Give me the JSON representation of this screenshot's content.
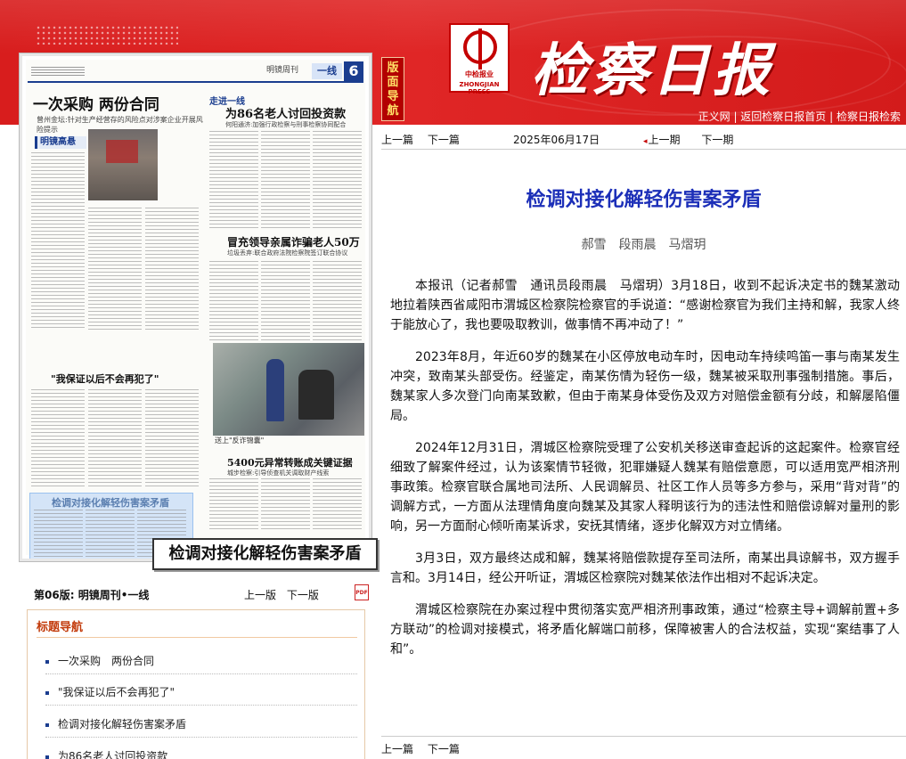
{
  "header": {
    "masthead": "检察日报",
    "logo_text_zh": "中检报业",
    "logo_text_en": "ZHONGJIAN PRESS",
    "topnav": [
      "正义网",
      "返回检察日报首页",
      "检察日报检索"
    ],
    "vertical_tab": "版面导航"
  },
  "thumbnail": {
    "page_number": "6",
    "section_tag": "一线",
    "section_weekly": "明镜周刊",
    "headline_main": "一次采购 两份合同",
    "headline_main_sub": "曾州金坛:针对生产经营存的风险点对涉案企业开展风险提示",
    "tag_mingjing": "明镜高悬",
    "column_zoujin": "走进一线",
    "headline_2": "为86名老人讨回投资款",
    "headline_2_sub": "何阳通济:加强行政检察与刑事检察协同配合",
    "headline_3": "冒充领导亲属诈骗老人50万",
    "headline_3_sub": "垃圾丢弃:联合政府法院检察院签订联合协议",
    "headline_4": "\"我保证以后不会再犯了\"",
    "headline_5": "5400元异常转账成关键证据",
    "headline_5_sub": "城步检察:引导侦查机关调取财产线索",
    "photo_caption": "送上\"反诈锦囊\"",
    "highlight_title": "检调对接化解轻伤害案矛盾",
    "article_label": "检调对接化解轻伤害案矛盾"
  },
  "page_info": {
    "page": "第06版:",
    "name": "明镜周刊•一线",
    "prev": "上一版",
    "next": "下一版"
  },
  "toc": {
    "title": "标题导航",
    "items": [
      "一次采购　两份合同",
      "\"我保证以后不会再犯了\"",
      "检调对接化解轻伤害案矛盾",
      "为86名老人讨回投资款"
    ]
  },
  "article_nav": {
    "prev": "上一篇",
    "next": "下一篇",
    "date": "2025年06月17日",
    "prev_issue": "上一期",
    "next_issue": "下一期"
  },
  "article": {
    "title": "检调对接化解轻伤害案矛盾",
    "authors": "郝雪　段雨晨　马熠玥",
    "paragraphs": [
      "本报讯（记者郝雪　通讯员段雨晨　马熠玥）3月18日，收到不起诉决定书的魏某激动地拉着陕西省咸阳市渭城区检察院检察官的手说道：“感谢检察官为我们主持和解，我家人终于能放心了，我也要吸取教训，做事情不再冲动了！”",
      "2023年8月，年近60岁的魏某在小区停放电动车时，因电动车持续鸣笛一事与南某发生冲突，致南某头部受伤。经鉴定，南某伤情为轻伤一级，魏某被采取刑事强制措施。事后，魏某家人多次登门向南某致歉，但由于南某身体受伤及双方对赔偿金额有分歧，和解屡陷僵局。",
      "2024年12月31日，渭城区检察院受理了公安机关移送审查起诉的这起案件。检察官经细致了解案件经过，认为该案情节轻微，犯罪嫌疑人魏某有赔偿意愿，可以适用宽严相济刑事政策。检察官联合属地司法所、人民调解员、社区工作人员等多方参与，采用“背对背”的调解方式，一方面从法理情角度向魏某及其家人释明该行为的违法性和赔偿谅解对量刑的影响，另一方面耐心倾听南某诉求，安抚其情绪，逐步化解双方对立情绪。",
      "3月3日，双方最终达成和解，魏某将赔偿款提存至司法所，南某出具谅解书，双方握手言和。3月14日，经公开听证，渭城区检察院对魏某依法作出相对不起诉决定。",
      "渭城区检察院在办案过程中贯彻落实宽严相济刑事政策，通过“检察主导+调解前置+多方联动”的检调对接模式，将矛盾化解端口前移，保障被害人的合法权益，实现“案结事了人和”。"
    ]
  }
}
